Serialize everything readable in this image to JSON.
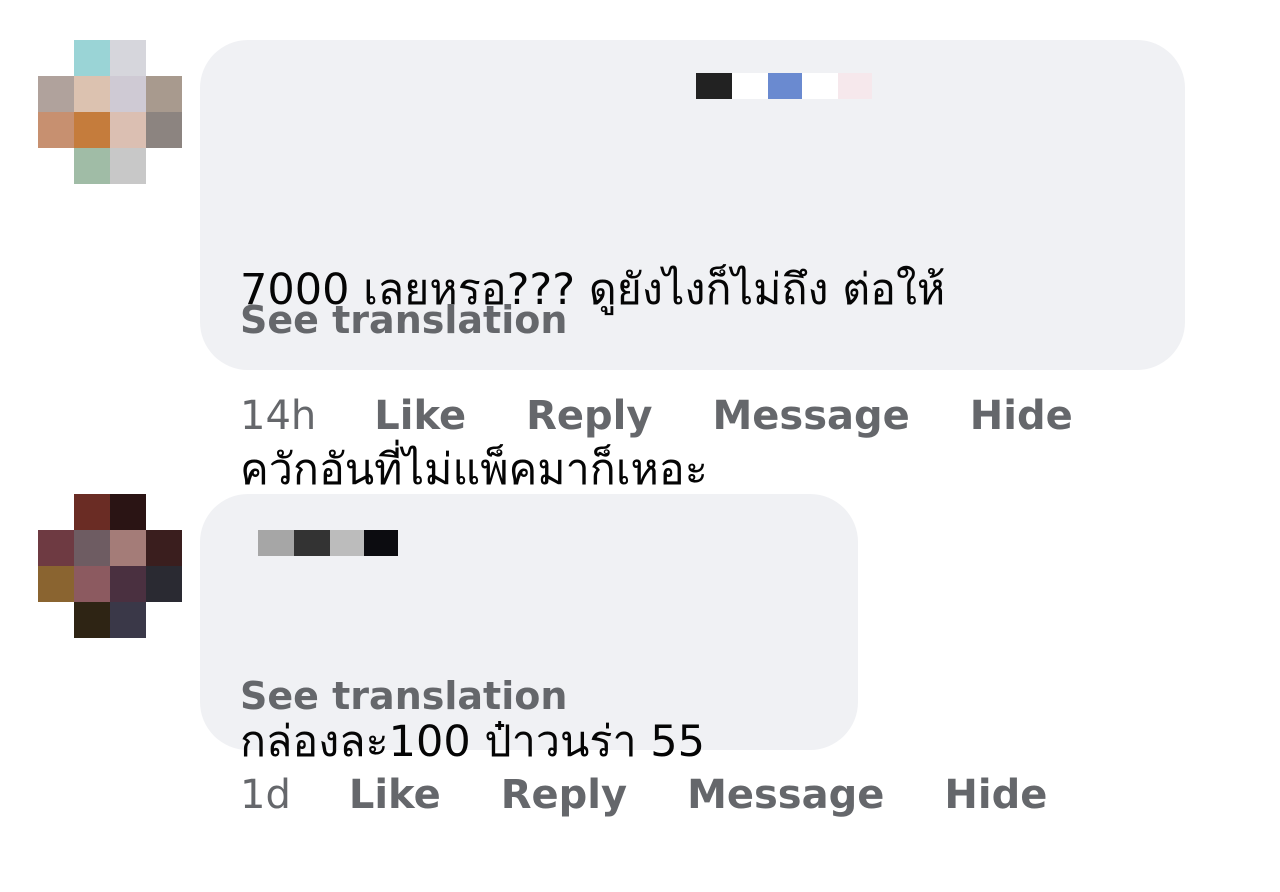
{
  "comments": [
    {
      "author_name": "",
      "text_line_1": "7000 เลยหรอ??? ดูยังไงก็ไม่ถึง ต่อให้",
      "text_line_2": "ควักอันที่ไม่แพ็คมาก็เหอะ",
      "see_translation": "See translation",
      "time": "14h",
      "actions": {
        "like": "Like",
        "reply": "Reply",
        "message": "Message",
        "hide": "Hide"
      },
      "avatar_pixels": [
        "#ffffff",
        "#9ad4d6",
        "#d6d6dc",
        "#ffffff",
        "#b0a29c",
        "#dcc2b0",
        "#cfcad4",
        "#a89a8e",
        "#c79070",
        "#c57c3c",
        "#dbbfb2",
        "#8c8480",
        "#ffffff",
        "#a0bca6",
        "#c8c8c8",
        "#ffffff"
      ],
      "name_mask_colors": [
        "#222222",
        "#ffffff",
        "#6a8ad0",
        "#ffffff",
        "#f6e8ec"
      ]
    },
    {
      "author_name": "",
      "text_line_1": "กล่องละ100 ป๋าวนร่า 55",
      "see_translation": "See translation",
      "time": "1d",
      "actions": {
        "like": "Like",
        "reply": "Reply",
        "message": "Message",
        "hide": "Hide"
      },
      "avatar_pixels": [
        "#ffffff",
        "#6a2c24",
        "#2a1414",
        "#ffffff",
        "#6e3a42",
        "#6e5c62",
        "#a47c78",
        "#3a1e1e",
        "#8a6430",
        "#8c5a60",
        "#4a3040",
        "#2a2a32",
        "#ffffff",
        "#2e2414",
        "#3a3848",
        "#ffffff"
      ],
      "name_mask_colors": [
        "#a6a6a6",
        "#333333",
        "#bcbcbc",
        "#0c0c10"
      ]
    }
  ]
}
